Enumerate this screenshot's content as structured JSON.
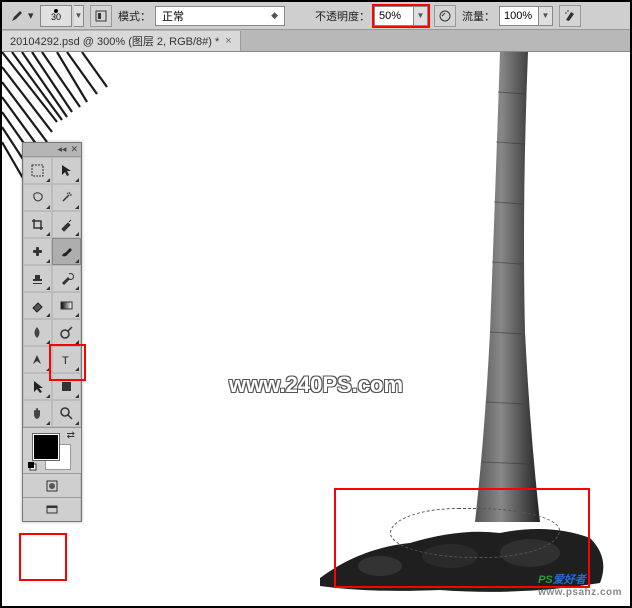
{
  "options": {
    "brush_size": "30",
    "mode_label": "模式：",
    "mode_value": "正常",
    "opacity_label": "不透明度：",
    "opacity_value": "50%",
    "flow_label": "流量：",
    "flow_value": "100%"
  },
  "tab": {
    "title": "20104292.psd @ 300% (图层 2, RGB/8#) *",
    "close": "×"
  },
  "watermark": "www.240PS.com",
  "brand": {
    "p": "PS",
    "s": "爱好者",
    "url": "www.psahz.com"
  },
  "tools": {
    "head_collapse": "◂◂",
    "head_close": "✕"
  }
}
